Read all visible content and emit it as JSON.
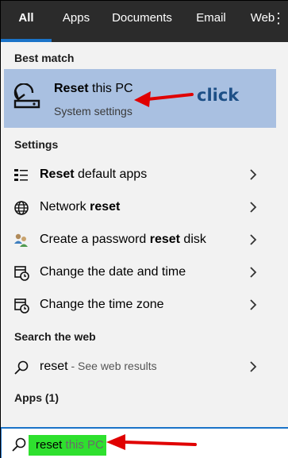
{
  "tabs": [
    {
      "label": "All",
      "active": true
    },
    {
      "label": "Apps",
      "active": false
    },
    {
      "label": "Documents",
      "active": false
    },
    {
      "label": "Email",
      "active": false
    },
    {
      "label": "Web",
      "active": false
    }
  ],
  "more_icon": "ellipsis-icon",
  "best_match": {
    "section_label": "Best match",
    "title_bold": "Reset",
    "title_rest": " this PC",
    "subtitle": "System settings",
    "icon": "reset-pc-icon"
  },
  "annotation": {
    "click_text": "click",
    "arrow_color": "#e00000"
  },
  "settings": {
    "section_label": "Settings",
    "items": [
      {
        "pre": "",
        "bold": "Reset",
        "post": " default apps",
        "icon": "default-apps-icon"
      },
      {
        "pre": "Network ",
        "bold": "reset",
        "post": "",
        "icon": "globe-icon"
      },
      {
        "pre": "Create a password ",
        "bold": "reset",
        "post": " disk",
        "icon": "users-key-icon"
      },
      {
        "pre": "Change the date and time",
        "bold": "",
        "post": "",
        "icon": "calendar-clock-icon"
      },
      {
        "pre": "Change the time zone",
        "bold": "",
        "post": "",
        "icon": "calendar-clock-icon"
      }
    ]
  },
  "web": {
    "section_label": "Search the web",
    "query": "reset",
    "hint": " - See web results",
    "icon": "search-icon"
  },
  "apps": {
    "section_label": "Apps (1)"
  },
  "search": {
    "typed": "reset",
    "suggested": " this PC",
    "highlight_color": "#2ee02e"
  },
  "colors": {
    "tabbar": "#2b2b2b",
    "accent": "#1a73c8",
    "selected": "#a9c0e1",
    "panel": "#f2f2f2"
  }
}
